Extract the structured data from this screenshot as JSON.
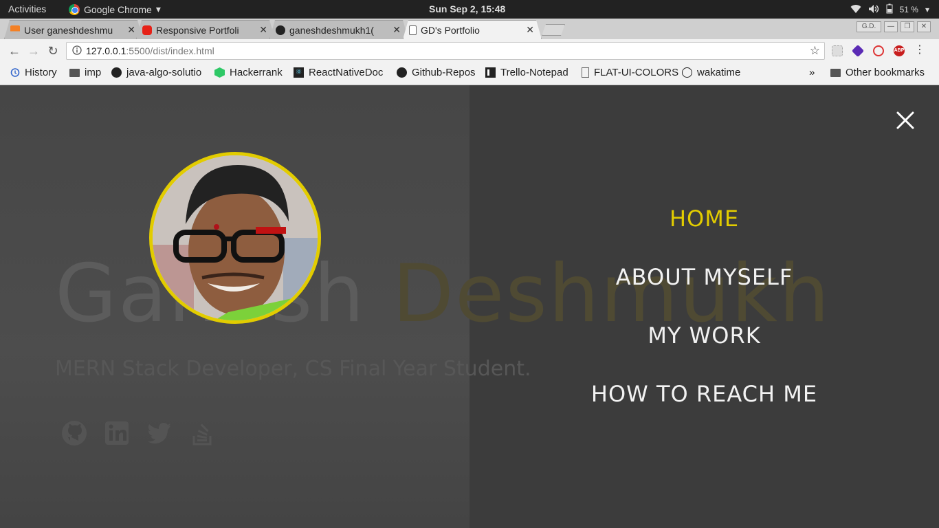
{
  "system_bar": {
    "activities": "Activities",
    "app_name": "Google Chrome",
    "clock": "Sun Sep  2, 15:48",
    "battery": "51 %"
  },
  "tabs": [
    {
      "title": "User ganeshdeshmu",
      "favicon": "stackoverflow-icon",
      "active": false
    },
    {
      "title": "Responsive Portfoli",
      "favicon": "youtube-icon",
      "active": false
    },
    {
      "title": "ganeshdeshmukh1(",
      "favicon": "github-icon",
      "active": false
    },
    {
      "title": "GD's Portfolio",
      "favicon": "page-icon",
      "active": true
    }
  ],
  "window_controls": {
    "profile": "G.D."
  },
  "address_bar": {
    "url_host": "127.0.0.1",
    "url_rest": ":5500/dist/index.html"
  },
  "bookmarks": [
    {
      "label": "History",
      "icon": "history-icon"
    },
    {
      "label": "imp",
      "icon": "folder-icon"
    },
    {
      "label": "java-algo-solutio",
      "icon": "github-icon"
    },
    {
      "label": "Hackerrank",
      "icon": "hackerrank-icon"
    },
    {
      "label": "ReactNativeDoc",
      "icon": "react-icon"
    },
    {
      "label": "Github-Repos",
      "icon": "github-icon"
    },
    {
      "label": "Trello-Notepad",
      "icon": "trello-icon"
    },
    {
      "label": "FLAT-UI-COLORS",
      "icon": "page-icon"
    },
    {
      "label": "wakatime",
      "icon": "wakatime-icon"
    }
  ],
  "bookmarks_overflow": "»",
  "other_bookmarks": "Other bookmarks",
  "hero": {
    "first_name": "Ganesh",
    "last_name": "Deshmukh",
    "subtitle": "MERN Stack Developer, CS Final Year Student."
  },
  "menu": {
    "items": [
      {
        "label": "HOME",
        "active": true
      },
      {
        "label": "ABOUT MYSELF",
        "active": false
      },
      {
        "label": "MY WORK",
        "active": false
      },
      {
        "label": "HOW TO REACH ME",
        "active": false
      }
    ]
  },
  "colors": {
    "accent": "#e2cc00",
    "overlay_right": "#3c3c3c",
    "overlay_left": "#474747"
  }
}
